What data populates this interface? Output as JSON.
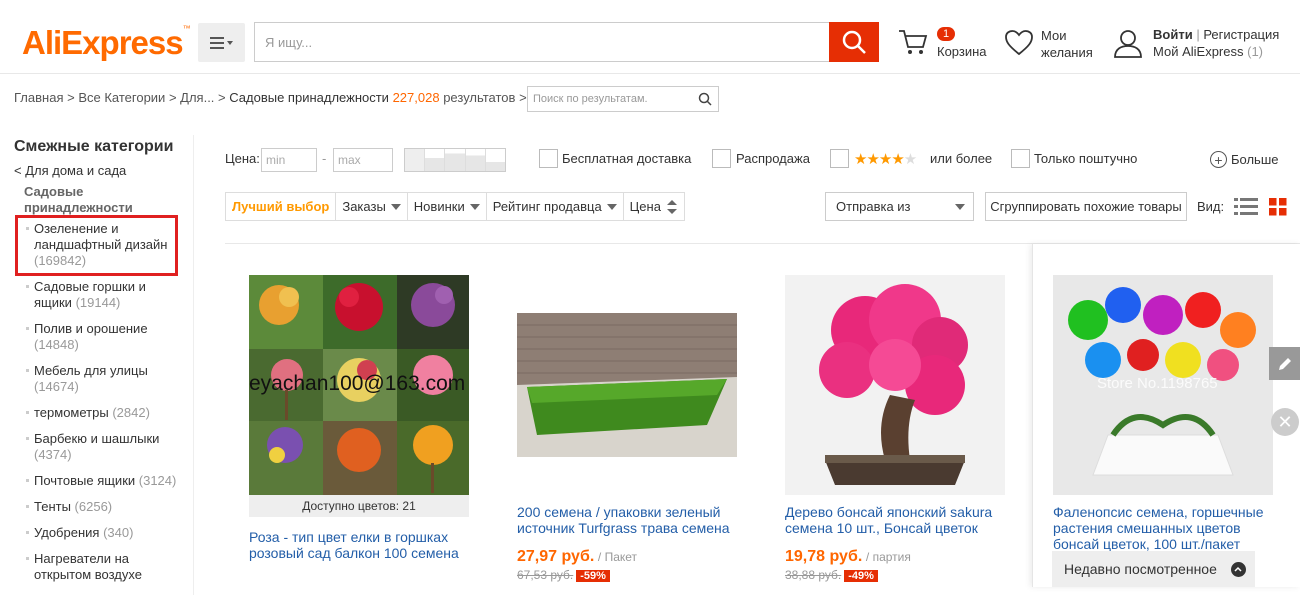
{
  "header": {
    "logo": "AliExpress",
    "search_placeholder": "Я ищу...",
    "cart_count": "1",
    "cart_label": "Корзина",
    "wishlist_line1": "Мои",
    "wishlist_line2": "желания",
    "signin": "Войти",
    "register": "Регистрация",
    "my_ali": "Мой AliExpress",
    "my_ali_count": "(1)"
  },
  "breadcrumb": {
    "items": [
      "Главная",
      "Все Категории",
      "Для..."
    ],
    "current": "Садовые принадлежности",
    "count": "227,028",
    "results": "результатов",
    "refine_placeholder": "Поиск по результатам."
  },
  "sidebar": {
    "title": "Смежные категории",
    "parent": "< Для дома и сада",
    "current": "Садовые принадлежности",
    "items": [
      {
        "label": "Озеленение и ландшафтный дизайн",
        "count": "(169842)"
      },
      {
        "label": "Садовые горшки и ящики",
        "count": "(19144)"
      },
      {
        "label": "Полив и орошение",
        "count": "(14848)"
      },
      {
        "label": "Мебель для улицы",
        "count": "(14674)"
      },
      {
        "label": "термометры",
        "count": "(2842)"
      },
      {
        "label": "Барбекю и шашлыки",
        "count": "(4374)"
      },
      {
        "label": "Почтовые ящики",
        "count": "(3124)"
      },
      {
        "label": "Тенты",
        "count": "(6256)"
      },
      {
        "label": "Удобрения",
        "count": "(340)"
      },
      {
        "label": "Нагреватели на открытом воздухе",
        "count": ""
      }
    ]
  },
  "filters": {
    "price_label": "Цена:",
    "min": "min",
    "max": "max",
    "free_shipping": "Бесплатная доставка",
    "sale": "Распродажа",
    "rating_suffix": "или более",
    "single": "Только поштучно",
    "more": "Больше",
    "stars": 4
  },
  "sort": {
    "items": [
      "Лучший выбор",
      "Заказы",
      "Новинки",
      "Рейтинг продавца",
      "Цена"
    ],
    "ship_from": "Отправка из",
    "group": "Сгруппировать похожие товары",
    "view_label": "Вид:"
  },
  "products": [
    {
      "title": "Роза - тип цвет елки в горшках розовый сад балкон 100 семена",
      "overlay": "Доступно цветов: 21",
      "watermark": "eyachan100@163.com",
      "price": "",
      "unit": "",
      "old": "",
      "disc": ""
    },
    {
      "title": "200 семена / упаковки зеленый источник Turfgrass трава семена",
      "price": "27,97 руб.",
      "unit": "/ Пакет",
      "old": "67,53 руб.",
      "disc": "-59%"
    },
    {
      "title": "Дерево бонсай японский sakura семена 10 шт., Бонсай цветок",
      "price": "19,78 руб.",
      "unit": "/ партия",
      "old": "38,88 руб.",
      "disc": "-49%"
    },
    {
      "title": "Фаленопсис семена, горшечные растения смешанных цветов бонсай цветок, 100 шт./пакет",
      "watermark": "Store No.1198765",
      "price": "",
      "unit": "",
      "old": "",
      "disc": ""
    }
  ],
  "recently_viewed": "Недавно посмотренное",
  "colors": {
    "brand": "#ff6a00",
    "accent": "#e62e04",
    "link": "#235ea8",
    "highlight": "#e02020"
  }
}
